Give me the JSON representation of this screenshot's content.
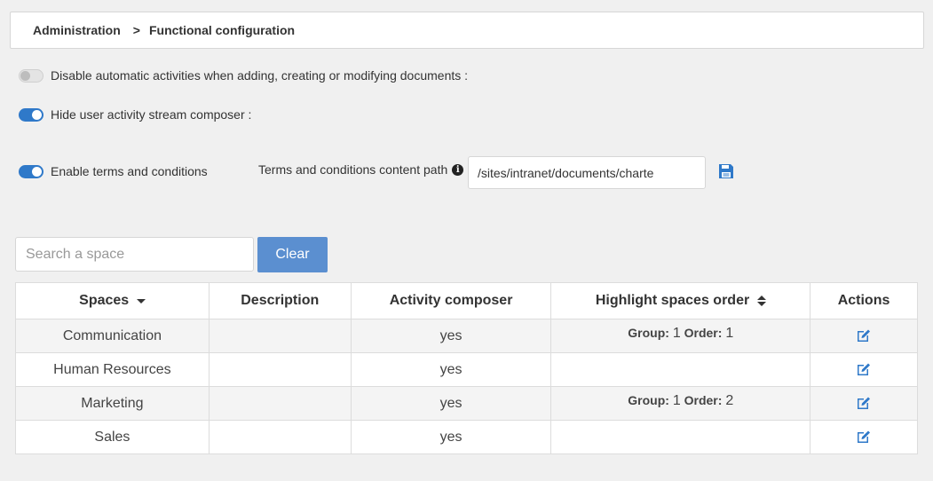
{
  "breadcrumb": {
    "root": "Administration",
    "separator": ">",
    "current": "Functional configuration"
  },
  "settings": {
    "disable_activities": {
      "label": "Disable automatic activities when adding, creating or modifying documents :",
      "enabled": false
    },
    "hide_composer": {
      "label": "Hide user activity stream composer :",
      "enabled": true
    },
    "terms": {
      "label": "Enable terms and conditions",
      "enabled": true
    },
    "terms_path_label": "Terms and conditions content path",
    "terms_path_value": "/sites/intranet/documents/charte"
  },
  "search": {
    "placeholder": "Search a space",
    "clear_label": "Clear"
  },
  "table": {
    "headers": {
      "spaces": "Spaces",
      "description": "Description",
      "activity_composer": "Activity composer",
      "highlight_order": "Highlight spaces order",
      "actions": "Actions"
    },
    "group_label": "Group:",
    "order_label": "Order:",
    "rows": [
      {
        "space": "Communication",
        "description": "",
        "composer": "yes",
        "group": "1",
        "order": "1"
      },
      {
        "space": "Human Resources",
        "description": "",
        "composer": "yes",
        "group": "",
        "order": ""
      },
      {
        "space": "Marketing",
        "description": "",
        "composer": "yes",
        "group": "1",
        "order": "2"
      },
      {
        "space": "Sales",
        "description": "",
        "composer": "yes",
        "group": "",
        "order": ""
      }
    ]
  },
  "colors": {
    "accent": "#2f79c9",
    "clear_button": "#5b8fd0",
    "background": "#f0f0f0"
  },
  "icons": {
    "save": "floppy-disk-icon",
    "edit": "edit-icon",
    "info": "info-icon",
    "sort": "sort-icon"
  }
}
